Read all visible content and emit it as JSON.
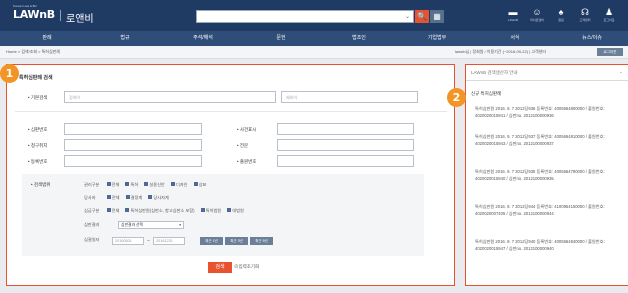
{
  "header": {
    "logo_sub": "Korean Law & Biz",
    "logo": "LAWnB",
    "logo_kr": "로앤비",
    "search_placeholder": "",
    "search_caret": "⌄",
    "search_icon": "🔍",
    "grid_icon": "▦",
    "utils": [
      {
        "icon": "▬",
        "label": "LAWnB"
      },
      {
        "icon": "☺",
        "label": "마이로앤비"
      },
      {
        "icon": "♠",
        "label": "알림"
      },
      {
        "icon": "☊",
        "label": "고객센터"
      },
      {
        "icon": "♟",
        "label": "로그아웃"
      }
    ]
  },
  "nav": [
    "판례",
    "법규",
    "주석/해석",
    "문헌",
    "법조인",
    "기업법무",
    "서식",
    "뉴스/이슈"
  ],
  "crumb": "Home > 검색/조회 > 특허심판례",
  "crumb_right": "lawnb님  |  정회원 / 이용기간 (~2016-09-22)  |  고객센터",
  "crumb_btn": "로그아웃",
  "main": {
    "badge": "1",
    "title": "특허심판례 검색",
    "basic_label": "• 기본검색",
    "basic_ph1": "검색어",
    "basic_ph2": "제외어",
    "fields": {
      "judgment_no": "• 심판번호",
      "case_type": "• 사건표시",
      "claim": "• 청구취지",
      "full_text": "• 전문",
      "reg_no": "• 등록번호",
      "app_no": "• 출원번호"
    },
    "scope_label": "• 검색범위",
    "rows": [
      {
        "label": "권리구분",
        "opts": [
          [
            "전체",
            true
          ],
          [
            "특허",
            true
          ],
          [
            "실용신안",
            true
          ],
          [
            "디자인",
            true
          ],
          [
            "상표",
            true
          ]
        ]
      },
      {
        "label": "당사자",
        "opts": [
          [
            "전체",
            true
          ],
          [
            "결정계",
            true
          ],
          [
            "당사자계",
            true
          ]
        ]
      },
      {
        "label": "심급구분",
        "opts": [
          [
            "전체",
            true
          ],
          [
            "특허심판원(심판소, 항고심판소 포함)",
            true
          ],
          [
            "특허법원",
            true
          ],
          [
            "대법원",
            true
          ]
        ]
      }
    ],
    "result_label": "심판결과",
    "result_value": "심판결과 선택",
    "date_label": "심결일자",
    "date_from": "20160501",
    "date_sep": "~",
    "date_to": "20161231",
    "year_btns": [
      "최근 1년",
      "최근 3년",
      "최근 5년"
    ],
    "search_btn": "검색",
    "reset": "입력초기화"
  },
  "side": {
    "badge": "2",
    "head": "LAWnB 검색생산자 안내",
    "sub": "신규 특허심판례",
    "entries": [
      "특허심판원 2016. 9. 7 2012당936 등록번호: 4005664800000 / 출원번호: 4020020015941 / 심판no. 2012100000936",
      "특허심판원 2016. 9. 7 2012당937 등록번호: 4005664810000 / 출원번호: 4020020015943 / 심판no. 2012100000937",
      "특허심판원 2016. 9. 7 2012당935 등록번호: 4005664790000 / 출원번호: 4020020015940 / 심판no. 2012100000935",
      "특허심판원 2016. 9. 7 2012당944 등록번호: 4100954150000 / 출원번호: 4020020007405 / 심판no. 2012100000944",
      "특허심판원 2016. 9. 7 2012당940 등록번호: 4005664840000 / 출원번호: 4020020015947 / 심판no. 2012100000940"
    ]
  }
}
